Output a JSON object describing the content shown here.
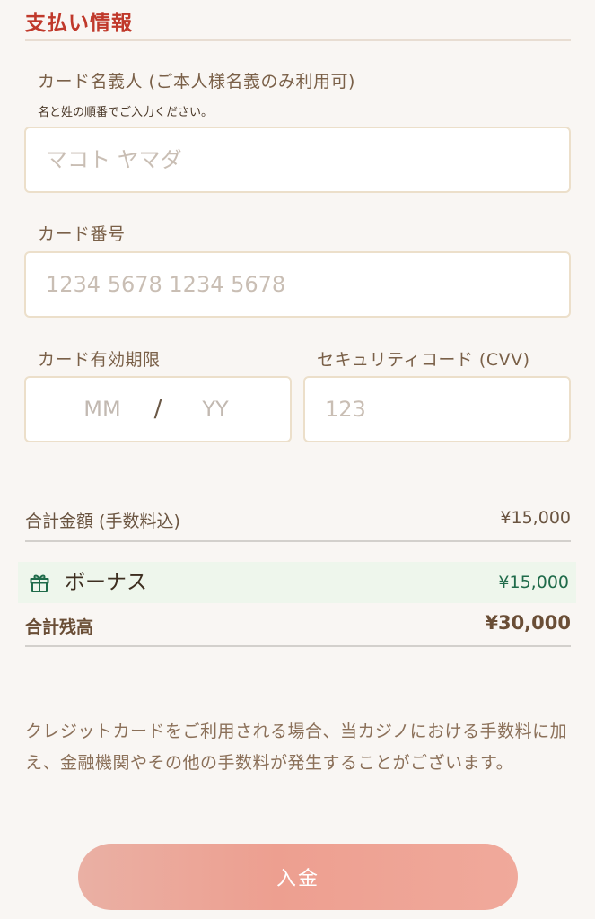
{
  "payment": {
    "section_title": "支払い情報",
    "cardholder": {
      "label": "カード名義人 (ご本人様名義のみ利用可)",
      "hint": "名と姓の順番でご入力ください。",
      "placeholder": "マコト ヤマダ"
    },
    "card_number": {
      "label": "カード番号",
      "placeholder": "1234 5678 1234 5678"
    },
    "expiry": {
      "label": "カード有効期限",
      "month_placeholder": "MM",
      "separator": "/",
      "year_placeholder": "YY"
    },
    "cvv": {
      "label": "セキュリティコード (CVV)",
      "placeholder": "123"
    }
  },
  "summary": {
    "total_label": "合計金額 (手数料込)",
    "total_value": "¥15,000",
    "bonus_icon": "gift-icon",
    "bonus_label": "ボーナス",
    "bonus_value": "¥15,000",
    "balance_label": "合計残高",
    "balance_value": "¥30,000"
  },
  "notice": "クレジットカードをご利用される場合、当カジノにおける手数料に加え、金融機関やその他の手数料が発生することがございます。",
  "deposit_button": "入金",
  "colors": {
    "title": "#c0392b",
    "bonus_value": "#1f6b4a",
    "bonus_background": "#eef6ec",
    "button": "#ed9f90"
  }
}
